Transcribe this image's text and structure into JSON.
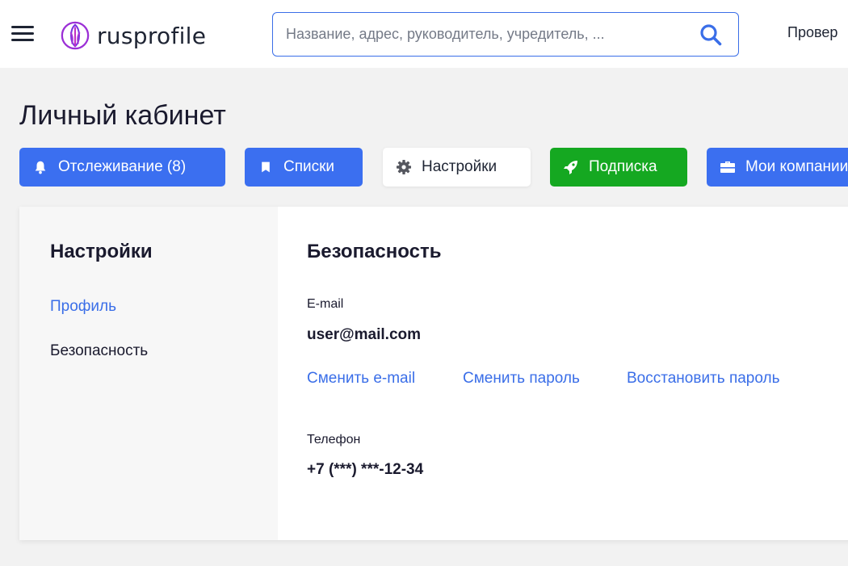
{
  "header": {
    "logo_text": "rusprofile",
    "search": {
      "placeholder": "Название, адрес, руководитель, учредитель, ...",
      "value": ""
    },
    "right_link": "Провер"
  },
  "page": {
    "title": "Личный кабинет"
  },
  "tabs": [
    {
      "label": "Отслеживание (8)",
      "icon": "bell-icon",
      "color": "#3b6ff0"
    },
    {
      "label": "Списки",
      "icon": "bookmark-icon",
      "color": "#3b6ff0"
    },
    {
      "label": "Настройки",
      "icon": "gear-icon",
      "color": "#ffffff",
      "active": true
    },
    {
      "label": "Подписка",
      "icon": "rocket-icon",
      "color": "#15a821"
    },
    {
      "label": "Мои компании",
      "icon": "briefcase-icon",
      "color": "#3b6ff0"
    }
  ],
  "sidebar": {
    "title": "Настройки",
    "items": [
      {
        "label": "Профиль",
        "active": true
      },
      {
        "label": "Безопасность",
        "active": false
      }
    ]
  },
  "security": {
    "title": "Безопасность",
    "email_label": "E-mail",
    "email_value": "user@mail.com",
    "links": [
      "Сменить e-mail",
      "Сменить пароль",
      "Восстановить пароль"
    ],
    "phone_label": "Телефон",
    "phone_value": "+7 (***) ***-12-34"
  },
  "colors": {
    "accent": "#3a6ee8",
    "green": "#15a821",
    "background": "#f2f2f2"
  }
}
